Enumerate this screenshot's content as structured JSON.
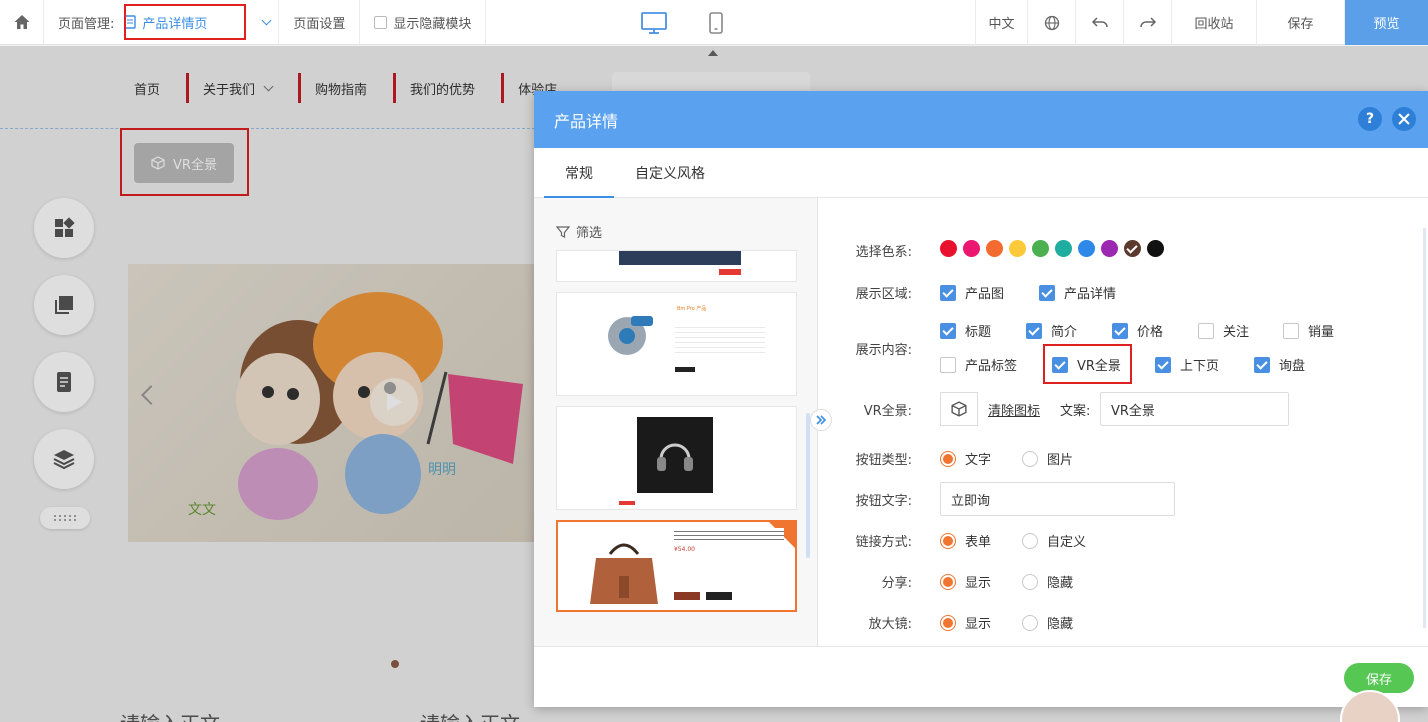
{
  "toolbar": {
    "page_mgmt_label": "页面管理:",
    "current_page": "产品详情页",
    "page_settings": "页面设置",
    "show_hidden": "显示隐藏模块",
    "lang": "中文",
    "recycle": "回收站",
    "save": "保存",
    "preview": "预览"
  },
  "site": {
    "nav": [
      "首页",
      "关于我们",
      "购物指南",
      "我们的优势",
      "体验店"
    ],
    "vr_chip": "VR全景",
    "placeholder_1": "请输入正文",
    "placeholder_2": "请输入正文"
  },
  "dialog": {
    "title": "产品详情",
    "help": "?",
    "tabs": [
      "常规",
      "自定义风格"
    ],
    "filter": "筛选",
    "labels": {
      "color": "选择色系:",
      "area": "展示区域:",
      "content": "展示内容:",
      "vr": "VR全景:",
      "btn_type": "按钮类型:",
      "btn_text": "按钮文字:",
      "link": "链接方式:",
      "share": "分享:",
      "zoom": "放大镜:"
    },
    "colors": [
      "#e8122e",
      "#ea1670",
      "#f36b2f",
      "#fcc93a",
      "#4caf50",
      "#1fad9f",
      "#2e88e8",
      "#9c27b0",
      "#5d3a2e",
      "#111111"
    ],
    "area_options": [
      {
        "label": "产品图",
        "checked": true
      },
      {
        "label": "产品详情",
        "checked": true
      }
    ],
    "content_row1": [
      {
        "label": "标题",
        "checked": true
      },
      {
        "label": "简介",
        "checked": true
      },
      {
        "label": "价格",
        "checked": true
      },
      {
        "label": "关注",
        "checked": false
      },
      {
        "label": "销量",
        "checked": false
      }
    ],
    "content_row2": [
      {
        "label": "产品标签",
        "checked": false
      },
      {
        "label": "VR全景",
        "checked": true
      },
      {
        "label": "上下页",
        "checked": true
      },
      {
        "label": "询盘",
        "checked": true
      }
    ],
    "vr_clear": "清除图标",
    "vr_copy_label": "文案:",
    "vr_copy_value": "VR全景",
    "btn_type": [
      "文字",
      "图片"
    ],
    "btn_text_value": "立即询",
    "link_type": [
      "表单",
      "自定义"
    ],
    "share": [
      "显示",
      "隐藏"
    ],
    "zoom": [
      "显示",
      "隐藏"
    ],
    "tpl_price": "¥54.00",
    "tpl_title_snip": "Bm Pro 产品",
    "save": "保存"
  }
}
